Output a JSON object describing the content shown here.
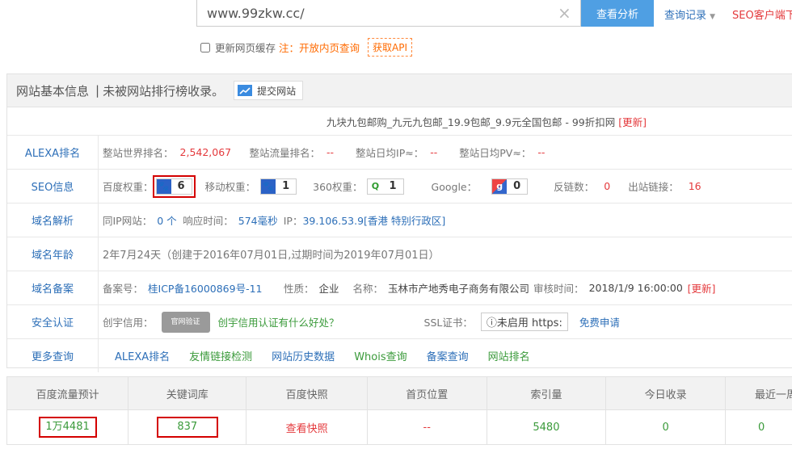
{
  "search": {
    "value": "www.99zkw.cc/",
    "clear_icon": "×",
    "analyze_label": "查看分析",
    "history_label": "查询记录",
    "seo_client": "SEO客户端下"
  },
  "cache": {
    "label": "更新网页缓存",
    "note": "注：开放内页查询",
    "api": "获取API"
  },
  "panel": {
    "title": "网站基本信息",
    "sep": "|",
    "subtitle": "未被网站排行榜收录。",
    "submit": "提交网站",
    "site_title": "九块九包邮购_九元九包邮_19.9包邮_9.9元全国包邮 - 99折扣网",
    "site_update": "[更新]",
    "alexa": {
      "label": "ALEXA排名",
      "world_label": "整站世界排名：",
      "world": "2,542,067",
      "flow_label": "整站流量排名：",
      "flow": "--",
      "ip_label": "整站日均IP≈：",
      "ip": "--",
      "pv_label": "整站日均PV≈：",
      "pv": "--"
    },
    "seo": {
      "label": "SEO信息",
      "baidu_label": "百度权重：",
      "baidu": "6",
      "mobile_label": "移动权重：",
      "mobile": "1",
      "q360_label": "360权重：",
      "q360": "1",
      "google_label": "Google：",
      "google": "0",
      "backlink_label": "反链数：",
      "backlink": "0",
      "out_label": "出站链接：",
      "out": "16"
    },
    "domain": {
      "label": "域名解析",
      "sameip_label": "同IP网站：",
      "sameip": "0 个",
      "resp_label": "响应时间：",
      "resp": "574毫秒",
      "ip_label": "IP：",
      "ip": "39.106.53.9[香港 特别行政区]"
    },
    "age": {
      "label": "域名年龄",
      "value": "2年7月24天（创建于2016年07月01日,过期时间为2019年07月01日）"
    },
    "icp": {
      "label": "域名备案",
      "no_label": "备案号：",
      "no": "桂ICP备16000869号-11",
      "type_label": "性质：",
      "type": "企业",
      "name_label": "名称：",
      "name": "玉林市产地秀电子商务有限公司",
      "time_label": "审核时间：",
      "time": "2018/1/9 16:00:00",
      "update": "[更新]"
    },
    "security": {
      "label": "安全认证",
      "credit_label": "创宇信用：",
      "seal_text": "官网验证",
      "credit_link": "创宇信用认证有什么好处？",
      "ssl_label": "SSL证书：",
      "https": "ⓘ未启用 https:",
      "free": "免费申请"
    },
    "more": {
      "label": "更多查询",
      "links": [
        "ALEXA排名",
        "友情链接检测",
        "网站历史数据",
        "Whois查询",
        "备案查询",
        "网站排名"
      ]
    }
  },
  "stats": {
    "headers": [
      "百度流量预计",
      "关键词库",
      "百度快照",
      "首页位置",
      "索引量",
      "今日收录",
      "最近一周"
    ],
    "values": [
      "1万4481",
      "837",
      "查看快照",
      "--",
      "5480",
      "0",
      "0"
    ]
  }
}
